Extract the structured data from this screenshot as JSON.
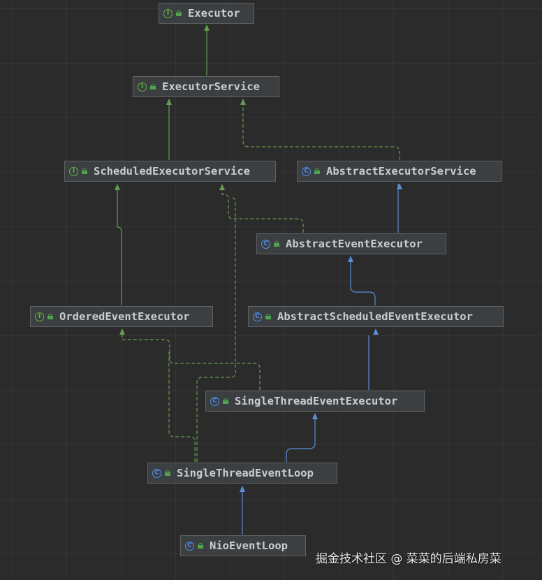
{
  "colors": {
    "interface_badge": "#62b543",
    "class_badge": "#4d8cf0",
    "interface_arrow": "#5f9e4f",
    "class_arrow": "#5b8ed6",
    "implements_dashed": "#6a9950"
  },
  "nodes": [
    {
      "id": "executor",
      "label": "Executor",
      "kind": "interface",
      "badge": "I"
    },
    {
      "id": "executor-service",
      "label": "ExecutorService",
      "kind": "interface",
      "badge": "I"
    },
    {
      "id": "scheduled-executor-service",
      "label": "ScheduledExecutorService",
      "kind": "interface",
      "badge": "I"
    },
    {
      "id": "abstract-executor-service",
      "label": "AbstractExecutorService",
      "kind": "class",
      "badge": "C"
    },
    {
      "id": "abstract-event-executor",
      "label": "AbstractEventExecutor",
      "kind": "class",
      "badge": "C"
    },
    {
      "id": "ordered-event-executor",
      "label": "OrderedEventExecutor",
      "kind": "interface",
      "badge": "I"
    },
    {
      "id": "abstract-scheduled-event-executor",
      "label": "AbstractScheduledEventExecutor",
      "kind": "class",
      "badge": "C"
    },
    {
      "id": "single-thread-event-executor",
      "label": "SingleThreadEventExecutor",
      "kind": "class",
      "badge": "C"
    },
    {
      "id": "single-thread-event-loop",
      "label": "SingleThreadEventLoop",
      "kind": "class",
      "badge": "C"
    },
    {
      "id": "nio-event-loop",
      "label": "NioEventLoop",
      "kind": "class",
      "badge": "C"
    }
  ],
  "edges": [
    {
      "from": "executor-service",
      "to": "executor",
      "type": "extends-interface"
    },
    {
      "from": "scheduled-executor-service",
      "to": "executor-service",
      "type": "extends-interface"
    },
    {
      "from": "abstract-executor-service",
      "to": "executor-service",
      "type": "implements"
    },
    {
      "from": "abstract-event-executor",
      "to": "abstract-executor-service",
      "type": "extends-class"
    },
    {
      "from": "abstract-event-executor",
      "to": "scheduled-executor-service",
      "type": "implements"
    },
    {
      "from": "ordered-event-executor",
      "to": "scheduled-executor-service",
      "type": "extends-interface"
    },
    {
      "from": "abstract-scheduled-event-executor",
      "to": "abstract-event-executor",
      "type": "extends-class"
    },
    {
      "from": "single-thread-event-executor",
      "to": "abstract-scheduled-event-executor",
      "type": "extends-class"
    },
    {
      "from": "single-thread-event-executor",
      "to": "ordered-event-executor",
      "type": "implements"
    },
    {
      "from": "single-thread-event-loop",
      "to": "single-thread-event-executor",
      "type": "extends-class"
    },
    {
      "from": "single-thread-event-loop",
      "to": "ordered-event-executor",
      "type": "implements"
    },
    {
      "from": "single-thread-event-loop",
      "to": "scheduled-executor-service",
      "type": "implements"
    },
    {
      "from": "nio-event-loop",
      "to": "single-thread-event-loop",
      "type": "extends-class"
    }
  ],
  "watermark": "掘金技术社区 @ 菜菜的后端私房菜"
}
